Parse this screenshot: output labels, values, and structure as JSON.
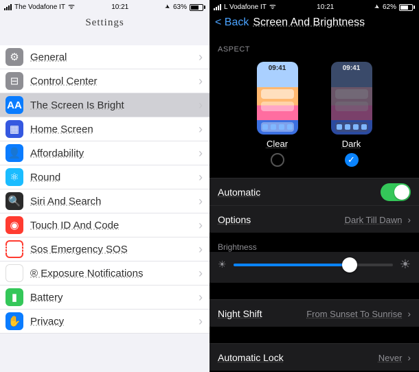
{
  "left": {
    "status": {
      "carrier": "The Vodafone IT",
      "time": "10:21",
      "battery_pct": "63%"
    },
    "title": "Settings",
    "items": [
      {
        "icon": "gear",
        "label": "General"
      },
      {
        "icon": "cc",
        "label": "Control Center"
      },
      {
        "icon": "aa",
        "label": "The Screen Is Bright",
        "selected": true
      },
      {
        "icon": "grid",
        "label": "Home Screen"
      },
      {
        "icon": "person",
        "label": "Affordability"
      },
      {
        "icon": "atom",
        "label": "Round"
      },
      {
        "icon": "search",
        "label": "Siri And Search"
      },
      {
        "icon": "touch",
        "label": "Touch ID And Code"
      },
      {
        "icon": "sos",
        "label": "Sos Emergency SOS"
      },
      {
        "icon": "exposure",
        "label": "® Exposure Notifications"
      },
      {
        "icon": "battery",
        "label": "Battery"
      },
      {
        "icon": "hand",
        "label": "Privacy"
      }
    ]
  },
  "right": {
    "status": {
      "carrier": "L Vodafone IT",
      "time": "10:21",
      "battery_pct": "62%"
    },
    "back_label": "Back",
    "title": "Screen And Brightness",
    "section_aspect": "ASPECT",
    "previews": {
      "clear": {
        "name": "Clear",
        "time": "09:41",
        "selected": false
      },
      "dark": {
        "name": "Dark",
        "time": "09:41",
        "selected": true
      }
    },
    "automatic_label": "Automatic",
    "automatic_on": true,
    "options_label": "Options",
    "options_value": "Dark Till Dawn",
    "brightness_label": "Brightness",
    "brightness_value": 0.73,
    "night_shift_label": "Night Shift",
    "night_shift_value": "From Sunset To Sunrise",
    "auto_lock_label": "Automatic Lock",
    "auto_lock_value": "Never"
  },
  "icons": {
    "gear": "⚙︎",
    "cc": "⊟",
    "aa": "AA",
    "grid": "▦",
    "person": "👤",
    "atom": "⚛︎",
    "search": "🔍",
    "touch": "◉",
    "sos": "SOS",
    "exposure": "⊙",
    "battery": "▮",
    "hand": "✋",
    "check": "✓",
    "sun_small": "☀︎",
    "sun_big": "☀︎",
    "loc": "➤"
  }
}
